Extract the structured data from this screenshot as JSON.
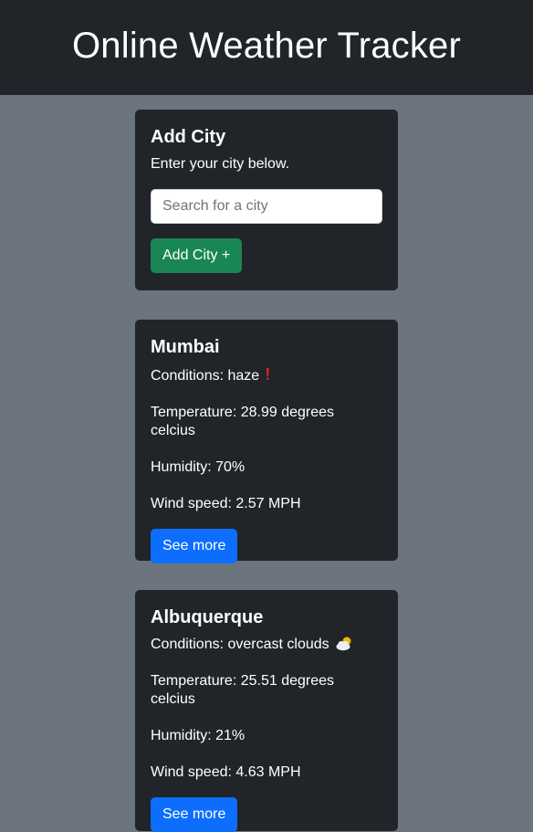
{
  "header": {
    "title": "Online Weather Tracker"
  },
  "add_city": {
    "title": "Add City",
    "subtitle": "Enter your city below.",
    "search_placeholder": "Search for a city",
    "button_label": "Add City +"
  },
  "cities": [
    {
      "name": "Mumbai",
      "conditions": "Conditions: haze",
      "condition_icon": "exclamation-icon",
      "temperature": "Temperature: 28.99 degrees celcius",
      "humidity": "Humidity: 70%",
      "wind": "Wind speed: 2.57 MPH",
      "button_label": "See more"
    },
    {
      "name": "Albuquerque",
      "conditions": "Conditions: overcast clouds",
      "condition_icon": "sun-behind-cloud-icon",
      "temperature": "Temperature: 25.51 degrees celcius",
      "humidity": "Humidity: 21%",
      "wind": "Wind speed: 4.63 MPH",
      "button_label": "See more"
    }
  ],
  "colors": {
    "page_background": "#6c757d",
    "card_background": "#212529",
    "add_button": "#198754",
    "see_more_button": "#0d6efd"
  }
}
